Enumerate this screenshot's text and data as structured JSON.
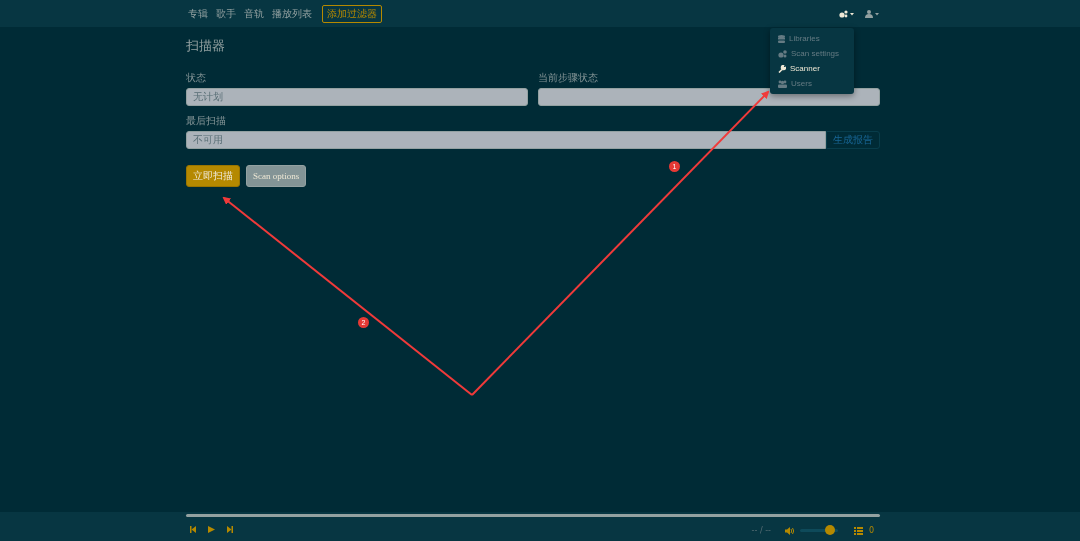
{
  "navbar": {
    "links": [
      {
        "label": "专辑"
      },
      {
        "label": "歌手"
      },
      {
        "label": "音轨"
      },
      {
        "label": "播放列表"
      }
    ],
    "filter_button": "添加过滤器"
  },
  "settings_menu": {
    "expanded": true,
    "items": [
      {
        "label": "Libraries",
        "selected": false
      },
      {
        "label": "Scan settings",
        "selected": false
      },
      {
        "label": "Scanner",
        "selected": true
      },
      {
        "label": "Users",
        "selected": false
      }
    ]
  },
  "page": {
    "title": "扫描器",
    "status_label": "状态",
    "status_value": "无计划",
    "step_label": "当前步骤状态",
    "last_scan_label": "最后扫描",
    "last_scan_value": "不可用",
    "report_button": "生成报告",
    "scan_now_button": "立即扫描",
    "scan_options_button": "Scan options"
  },
  "player": {
    "time": "-- / --",
    "volume": {
      "level": 0.8
    },
    "queue_count": "0"
  },
  "annotations": [
    {
      "label": "1"
    },
    {
      "label": "2"
    }
  ]
}
